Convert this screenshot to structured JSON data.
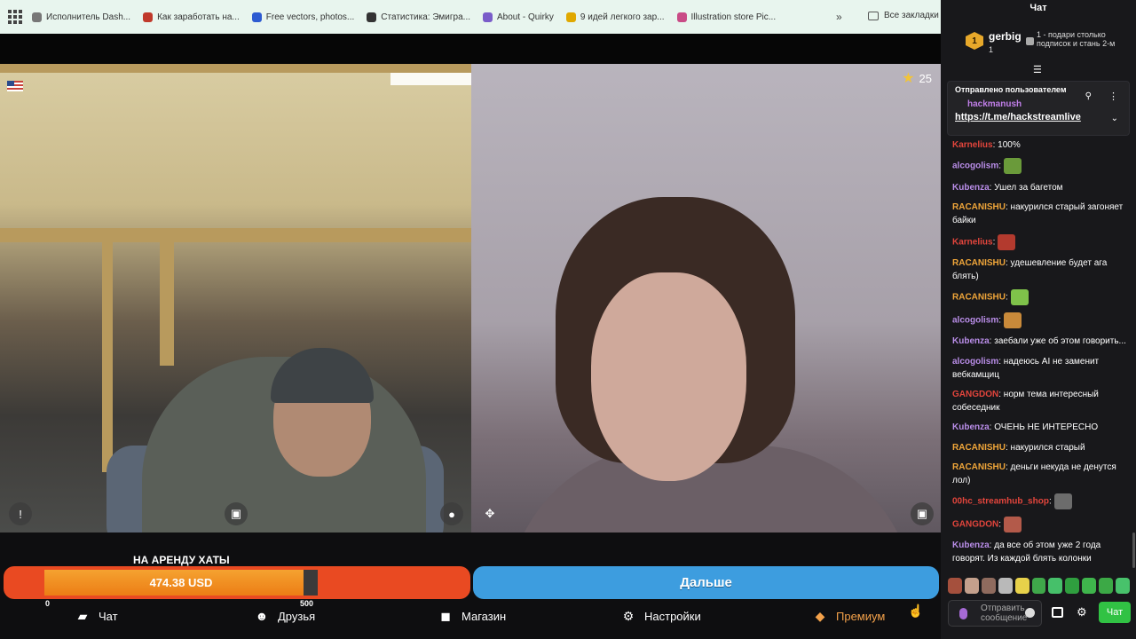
{
  "bookmarks": {
    "items": [
      {
        "label": "Исполнитель Dash...",
        "color": "#777777"
      },
      {
        "label": "Как заработать на...",
        "color": "#c0392b"
      },
      {
        "label": "Free vectors, photos...",
        "color": "#2d5bd1"
      },
      {
        "label": "Статистика: Эмигра...",
        "color": "#333333"
      },
      {
        "label": "About - Quirky",
        "color": "#7a5cc9"
      },
      {
        "label": "9 идей легкого зар...",
        "color": "#e0a800"
      },
      {
        "label": "Illustration store Pic...",
        "color": "#c94b86"
      }
    ],
    "more_label": "»",
    "folder_label": "Все закладки"
  },
  "video_right": {
    "star_count": "25"
  },
  "bottom": {
    "rent_label": "НА АРЕНДУ ХАТЫ",
    "rent_value": "474.38 USD",
    "rent_progress": 0.949,
    "scale_min": "0",
    "scale_max": "500",
    "next_label": "Дальше",
    "nav": {
      "chat": "Чат",
      "friends": "Друзья",
      "shop": "Магазин",
      "settings": "Настройки",
      "premium": "Премиум"
    }
  },
  "chat": {
    "title": "Чат",
    "gift": {
      "user": "gerbig",
      "count": "1",
      "badge": "1",
      "text": "1 - подари столько подписок и стань 2-м"
    },
    "pinned": {
      "title": "Отправлено пользователем",
      "user": "hackmanush",
      "link": "https://t.me/hackstreamlive"
    },
    "messages": [
      {
        "user": "Karnelius",
        "color": "#e2453c",
        "text": ": 100%",
        "emote": null
      },
      {
        "user": "alcogolism",
        "color": "#b98de8",
        "text": ":",
        "emote": "#6a9a3a"
      },
      {
        "user": "Kubenza",
        "color": "#b98de8",
        "text": ": Ушел за багетом",
        "emote": null
      },
      {
        "user": "RACANISHU",
        "color": "#f0a63a",
        "text": ": накурился старый загоняет байки",
        "emote": null
      },
      {
        "user": "Karnelius",
        "color": "#e2453c",
        "text": ":",
        "emote": "#b33a2e"
      },
      {
        "user": "RACANISHU",
        "color": "#f0a63a",
        "text": ": удешевление будет ага блять)",
        "emote": null
      },
      {
        "user": "RACANISHU",
        "color": "#f0a63a",
        "text": ":",
        "emote": "#7fc24a"
      },
      {
        "user": "alcogolism",
        "color": "#b98de8",
        "text": ":",
        "emote": "#c98a3a"
      },
      {
        "user": "Kubenza",
        "color": "#b98de8",
        "text": ": заебали уже об этом говорить...",
        "emote": null
      },
      {
        "user": "alcogolism",
        "color": "#b98de8",
        "text": ": надеюсь AI не заменит вебкамщиц",
        "emote": null
      },
      {
        "user": "GANGDON",
        "color": "#e2453c",
        "text": ": норм тема интересный собеседник",
        "emote": null
      },
      {
        "user": "Kubenza",
        "color": "#b98de8",
        "text": ": ОЧЕНЬ НЕ ИНТЕРЕСНО",
        "emote": null
      },
      {
        "user": "RACANISHU",
        "color": "#f0a63a",
        "text": ": накурился старый",
        "emote": null
      },
      {
        "user": "RACANISHU",
        "color": "#f0a63a",
        "text": ": деньги некуда не денутся лол)",
        "emote": null
      },
      {
        "user": "00hc_streamhub_shop",
        "color": "#e2453c",
        "text": ":",
        "emote": "#6c6c6c"
      },
      {
        "user": "GANGDON",
        "color": "#e2453c",
        "text": ":",
        "emote": "#b35a4a"
      },
      {
        "user": "Kubenza",
        "color": "#b98de8",
        "text": ": да все об этом уже 2 года говорят. Из каждой блять колонки",
        "emote": null
      }
    ],
    "emote_bar": [
      "#a5503d",
      "#c4a08c",
      "#8f6b5e",
      "#b9b9b9",
      "#e7d14a",
      "#3fa84a",
      "#46c06a",
      "#2f9f3f",
      "#3fb54c",
      "#3ca946",
      "#48c26b"
    ],
    "input_placeholder": "Отправить сообщение",
    "send_label": "Чат"
  }
}
